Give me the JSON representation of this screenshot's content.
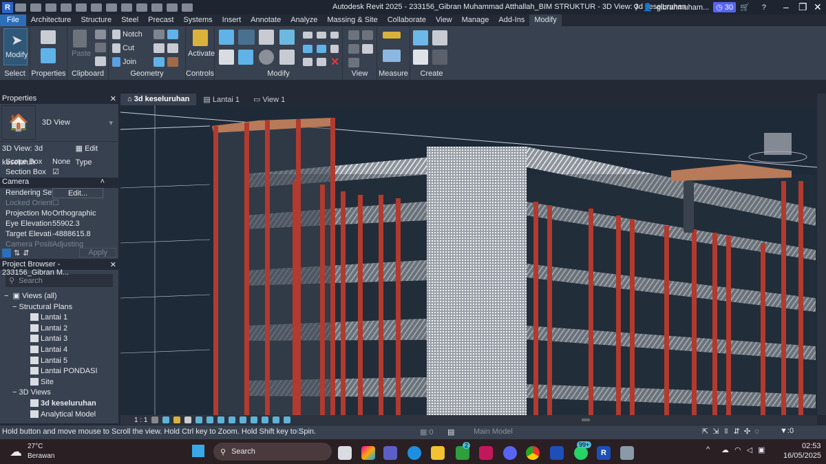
{
  "title": "Autodesk Revit 2025 - 233156_Gibran Muhammad Atthallah_BIM STRUKTUR - 3D View: 3d keseluruhan",
  "user": "gibranmuham...",
  "timer": "30",
  "menu": [
    "File",
    "Architecture",
    "Structure",
    "Steel",
    "Precast",
    "Systems",
    "Insert",
    "Annotate",
    "Analyze",
    "Massing & Site",
    "Collaborate",
    "View",
    "Manage",
    "Add-Ins",
    "Modify"
  ],
  "ribbon": {
    "modify": "Modify",
    "paste": "Paste",
    "notch": "Notch",
    "cut": "Cut",
    "join": "Join",
    "activate": "Activate",
    "groups": [
      "Select",
      "Properties",
      "Clipboard",
      "Geometry",
      "Controls",
      "Modify",
      "View",
      "Measure",
      "Create"
    ]
  },
  "properties": {
    "header": "Properties",
    "type": "3D View",
    "instance": "3D View: 3d keseluruh",
    "edit_type": "Edit Type",
    "rows": [
      {
        "k": "Scope Box",
        "v": "None"
      },
      {
        "k": "Section Box",
        "v": "☑"
      }
    ],
    "camera": "Camera",
    "camera_rows": [
      {
        "k": "Rendering Set...",
        "v": "Edit..."
      },
      {
        "k": "Locked Orient...",
        "v": ""
      },
      {
        "k": "Projection Mo...",
        "v": "Orthographic"
      },
      {
        "k": "Eye Elevation",
        "v": "55902.3"
      },
      {
        "k": "Target Elevati...",
        "v": "-4888615.8"
      },
      {
        "k": "Camera Positi...",
        "v": "Adjusting"
      }
    ],
    "apply": "Apply"
  },
  "browser": {
    "header": "Project Browser - 233156_Gibran M...",
    "search": "Search",
    "views_all": "Views (all)",
    "structural_plans": "Structural Plans",
    "plans": [
      "Lantai 1",
      "Lantai 2",
      "Lantai 3",
      "Lantai 4",
      "Lantai 5",
      "Lantai PONDASI",
      "Site"
    ],
    "views_3d": "3D Views",
    "views3d_items": [
      "3d keseluruhan",
      "Analytical Model"
    ]
  },
  "viewtabs": [
    "3d keseluruhan",
    "Lantai 1",
    "View 1"
  ],
  "scale": "1 : 1",
  "status": "Hold button and move mouse to Scroll the view. Hold Ctrl key to Zoom. Hold Shift key to Spin.",
  "workset_count": ":0",
  "model": "Main Model",
  "filter_count": ":0",
  "taskbar": {
    "temp": "27°C",
    "weather": "Berawan",
    "search": "Search",
    "time": "02:53",
    "date": "16/05/2025",
    "xbox_badge": "2",
    "whatsapp_badge": "99+"
  }
}
